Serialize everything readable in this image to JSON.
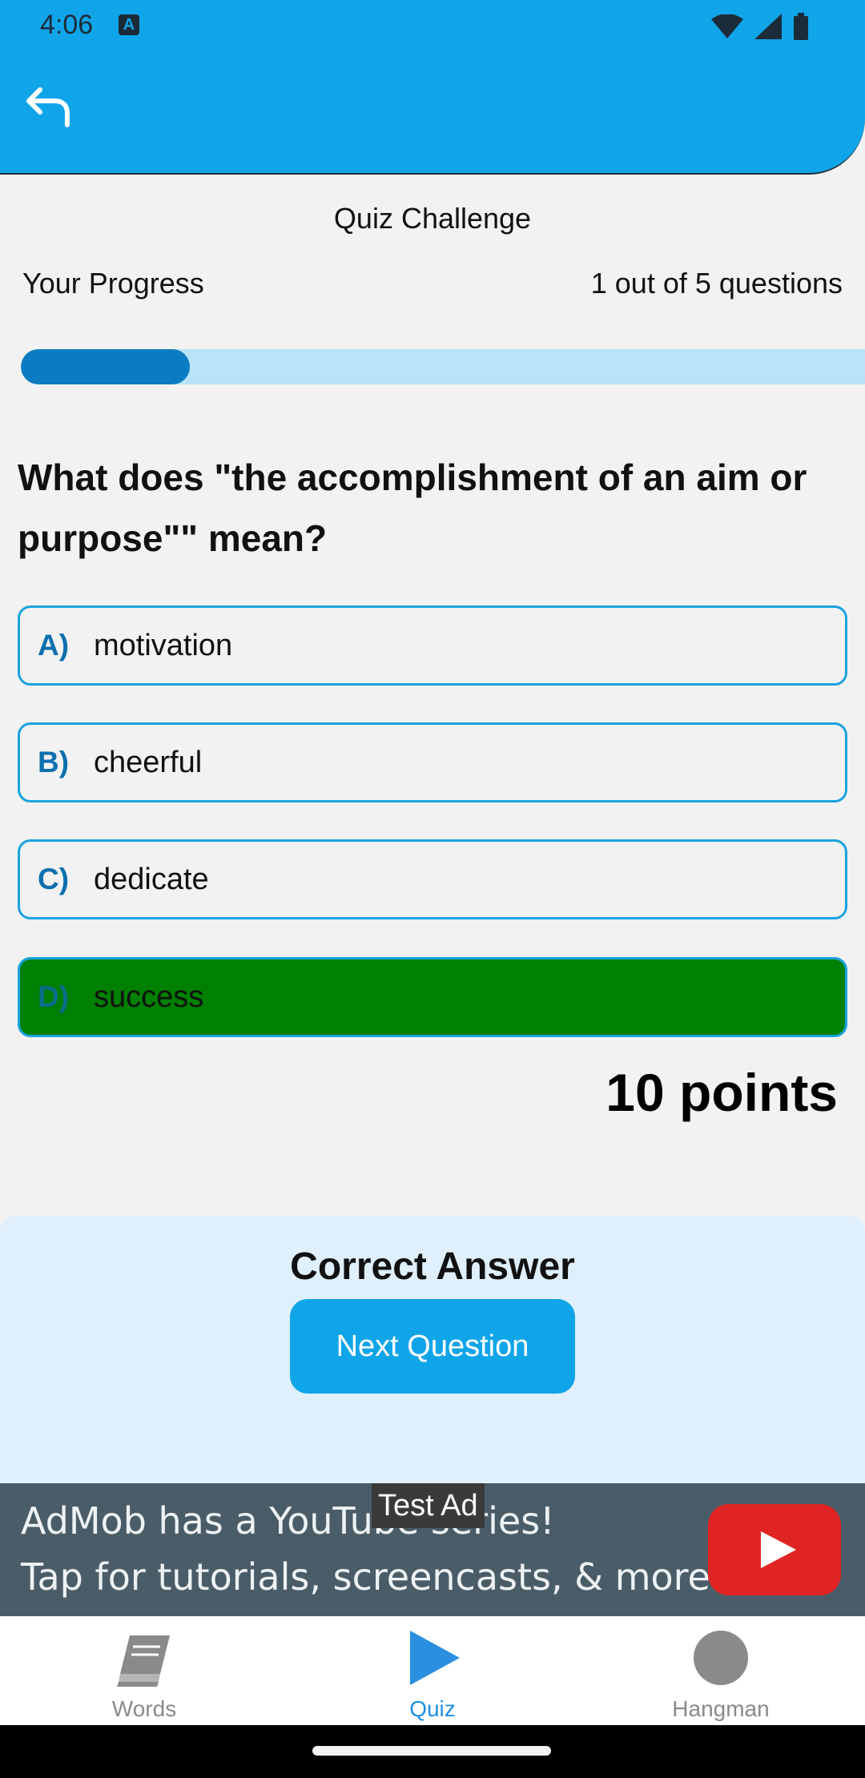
{
  "status_bar": {
    "time": "4:06",
    "notification_icon": "a-icon",
    "icons": [
      "wifi-icon",
      "signal-icon",
      "battery-icon"
    ]
  },
  "header": {
    "back_icon": "back-arrow-icon",
    "color": "#10a5e8"
  },
  "quiz": {
    "title": "Quiz Challenge",
    "progress_label": "Your Progress",
    "progress_count": "1 out of 5 questions",
    "progress_fraction": 0.2,
    "question": "What does \"the accomplishment of an aim or purpose\"\" mean?",
    "options": [
      {
        "letter": "A)",
        "text": "motivation",
        "state": "default"
      },
      {
        "letter": "B)",
        "text": "cheerful",
        "state": "default"
      },
      {
        "letter": "C)",
        "text": "dedicate",
        "state": "default"
      },
      {
        "letter": "D)",
        "text": "success",
        "state": "correct"
      }
    ],
    "points": "10 points",
    "correct_color": "#008000",
    "option_border_color": "#1ba3df"
  },
  "result": {
    "text": "Correct Answer",
    "next_label": "Next Question"
  },
  "ad": {
    "badge": "Test Ad",
    "line1": "AdMob has a YouTube series!",
    "line2": "Tap for tutorials, screencasts, & more.",
    "icon": "youtube-play-icon"
  },
  "bottom_nav": {
    "items": [
      {
        "label": "Words",
        "icon": "book-icon",
        "active": false
      },
      {
        "label": "Quiz",
        "icon": "play-icon",
        "active": true
      },
      {
        "label": "Hangman",
        "icon": "circle-icon",
        "active": false
      }
    ],
    "active_color": "#1f8fe0"
  }
}
